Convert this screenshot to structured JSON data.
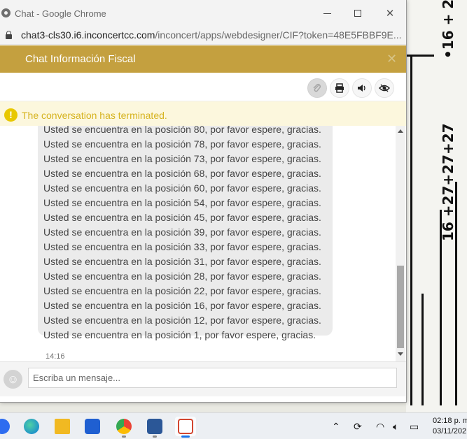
{
  "window": {
    "title": "Chat - Google Chrome",
    "url_host": "chat3-cls30.i6.inconcertcc.com",
    "url_path": "/inconcert/apps/webdesigner/CIF?token=48E5FBBF9E..."
  },
  "chat": {
    "title": "Chat Información Fiscal",
    "close_label": "✕",
    "notice": "The conversation has terminated.",
    "input_placeholder": "Escriba un mensaje...",
    "message_time": "14:16",
    "message_lines": [
      "Usted se encuentra en la posición 80, por favor espere, gracias.",
      "Usted se encuentra en la posición 78, por favor espere, gracias.",
      "Usted se encuentra en la posición 73, por favor espere, gracias.",
      "Usted se encuentra en la posición 68, por favor espere, gracias.",
      "Usted se encuentra en la posición 60, por favor espere, gracias.",
      "Usted se encuentra en la posición 54, por favor espere, gracias.",
      "Usted se encuentra en la posición 45, por favor espere, gracias.",
      "Usted se encuentra en la posición 39, por favor espere, gracias.",
      "Usted se encuentra en la posición 33, por favor espere, gracias.",
      "Usted se encuentra en la posición 31, por favor espere, gracias.",
      "Usted se encuentra en la posición 28, por favor espere, gracias.",
      "Usted se encuentra en la posición 22, por favor espere, gracias.",
      "Usted se encuentra en la posición 16, por favor espere, gracias.",
      "Usted se encuentra en la posición 12, por favor espere, gracias.",
      "Usted se encuentra en la posición 1, por favor espere, gracias."
    ],
    "toolbar_icons": [
      "paperclip-icon",
      "print-icon",
      "volume-icon",
      "eye-icon"
    ],
    "header_color": "#c4a03f",
    "notice_color": "#d6b31f"
  },
  "background_sketch": {
    "text_1": "•16 + 2",
    "text_2": "16 +27+27+27"
  },
  "taskbar": {
    "apps": [
      "zoom-icon",
      "edge-icon",
      "file-explorer-icon",
      "store-icon",
      "chrome-icon",
      "word-icon",
      "snipping-tool-icon"
    ],
    "time": "02:18 p. m.",
    "date": "03/11/202"
  }
}
